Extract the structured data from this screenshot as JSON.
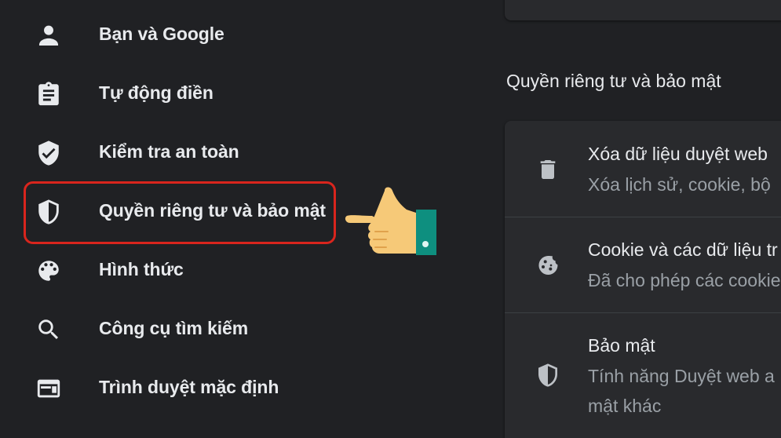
{
  "sidebar": {
    "items": [
      {
        "label": "Bạn và Google",
        "icon": "person-icon"
      },
      {
        "label": "Tự động điền",
        "icon": "clipboard-icon"
      },
      {
        "label": "Kiểm tra an toàn",
        "icon": "shield-check-icon"
      },
      {
        "label": "Quyền riêng tư và bảo mật",
        "icon": "shield-icon",
        "highlighted": true
      },
      {
        "label": "Hình thức",
        "icon": "palette-icon"
      },
      {
        "label": "Công cụ tìm kiếm",
        "icon": "search-icon"
      },
      {
        "label": "Trình duyệt mặc định",
        "icon": "browser-icon"
      }
    ]
  },
  "annotation": {
    "highlight_color": "#d9251d",
    "pointer": "pointing-hand-icon"
  },
  "main": {
    "section_title": "Quyền riêng tư và bảo mật",
    "rows": [
      {
        "title": "Xóa dữ liệu duyệt web",
        "subtitle": "Xóa lịch sử, cookie, bộ",
        "icon": "trash-icon"
      },
      {
        "title": "Cookie và các dữ liệu tr",
        "subtitle": "Đã cho phép các cookie",
        "icon": "cookie-icon"
      },
      {
        "title": "Bảo mật",
        "subtitle": "Tính năng Duyệt web a",
        "subtitle2": "mật khác",
        "icon": "shield-icon"
      }
    ]
  },
  "colors": {
    "background": "#202124",
    "card": "#292a2d",
    "text": "#e8eaed",
    "muted": "#9aa0a6"
  }
}
